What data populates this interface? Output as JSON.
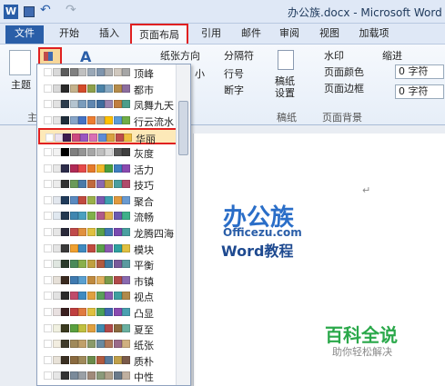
{
  "titlebar": {
    "title": "办公族.docx - Microsoft Word",
    "minimize": "–",
    "maximize": "□",
    "app_icon": "W",
    "undo": "↶",
    "redo": "↷"
  },
  "tabs": [
    {
      "label": "文件",
      "active": false
    },
    {
      "label": "开始",
      "active": false
    },
    {
      "label": "插入",
      "active": false
    },
    {
      "label": "页面布局",
      "active": true
    },
    {
      "label": "引用",
      "active": false
    },
    {
      "label": "邮件",
      "active": false
    },
    {
      "label": "审阅",
      "active": false
    },
    {
      "label": "视图",
      "active": false
    },
    {
      "label": "加载项",
      "active": false
    }
  ],
  "ribbon": {
    "themes_label": "主题",
    "themes_group": "主题",
    "paper_direction": "纸张方向",
    "separator": "分隔符",
    "line_number": "行号",
    "hyphenation": "断字",
    "small": "小",
    "draft": "稿纸",
    "draft_settings": "稿纸\n设置",
    "draft_group": "稿纸",
    "watermark": "水印",
    "page_color": "页面颜色",
    "page_border": "页面边框",
    "page_bg_group": "页面背景",
    "indent_label": "缩进",
    "indent_left": "0 字符",
    "indent_right": "0 字符"
  },
  "colors": {
    "red_highlight": "#e02020",
    "accent_blue": "#2a5ea8"
  },
  "gallery": {
    "items": [
      {
        "label": "顶峰",
        "swatches": [
          "#ffffff",
          "#d9d9d9",
          "#5c5c5c",
          "#808080",
          "#c0c0c0",
          "#9aa8b7",
          "#7f95ad",
          "#b0b0b0",
          "#d0c8be",
          "#a6a6a6"
        ]
      },
      {
        "label": "都市",
        "swatches": [
          "#ffffff",
          "#d9d9d9",
          "#2a2a2a",
          "#c4b28c",
          "#d44b2a",
          "#8da04b",
          "#4b83a8",
          "#88a9c2",
          "#b58c4b",
          "#8c6d9e"
        ]
      },
      {
        "label": "凤舞九天",
        "swatches": [
          "#ffffff",
          "#e2e2e2",
          "#2d3d4d",
          "#b4c4d0",
          "#7a9cbc",
          "#5f86b0",
          "#3f6c9e",
          "#9a84b0",
          "#c07e3f",
          "#4b9e8a"
        ]
      },
      {
        "label": "行云流水",
        "swatches": [
          "#ffffff",
          "#e4e4e4",
          "#1f2d3a",
          "#87a5c8",
          "#4472c4",
          "#ed7d31",
          "#a5a5a5",
          "#ffc000",
          "#5b9bd5",
          "#70ad47"
        ]
      },
      {
        "label": "华丽",
        "swatches": [
          "#ffffff",
          "#ece2f0",
          "#3c1c4f",
          "#cc4a7f",
          "#9a55c0",
          "#d96fb4",
          "#5e8bd6",
          "#d9a03f",
          "#bd4b4b",
          "#eebd3f"
        ]
      },
      {
        "label": "灰度",
        "swatches": [
          "#ffffff",
          "#f2f2f2",
          "#000000",
          "#7f7f7f",
          "#959595",
          "#a6a6a6",
          "#bfbfbf",
          "#d9d9d9",
          "#595959",
          "#3f3f3f"
        ]
      },
      {
        "label": "活力",
        "swatches": [
          "#ffffff",
          "#e8e8e8",
          "#2c2c4a",
          "#b02a56",
          "#e64a4a",
          "#e67a2a",
          "#f0b82a",
          "#4a9e3f",
          "#3f7ec0",
          "#8a4ab0"
        ]
      },
      {
        "label": "技巧",
        "swatches": [
          "#ffffff",
          "#ececec",
          "#333333",
          "#6a9a5a",
          "#4a7aa8",
          "#c06a3f",
          "#8a6ab0",
          "#c0a03f",
          "#4a9e9e",
          "#b04a6a"
        ]
      },
      {
        "label": "聚合",
        "swatches": [
          "#ffffff",
          "#e2e7ee",
          "#1f3a5a",
          "#5a8ac0",
          "#c04a3f",
          "#9ab04a",
          "#7a5ab0",
          "#3fa0b0",
          "#e09a3f",
          "#6a9ad0"
        ]
      },
      {
        "label": "流畅",
        "swatches": [
          "#ffffff",
          "#e0e8f0",
          "#22384f",
          "#3f86b0",
          "#4aa0c0",
          "#80b04a",
          "#b05a8a",
          "#e0b04a",
          "#6a5ab0",
          "#3fb08a"
        ]
      },
      {
        "label": "龙腾四海",
        "swatches": [
          "#ffffff",
          "#e6e6e6",
          "#2a2a3a",
          "#c04a4a",
          "#e0903f",
          "#e0c03f",
          "#5aa04a",
          "#3f7ab0",
          "#7a4ab0",
          "#4aa0a0"
        ]
      },
      {
        "label": "模块",
        "swatches": [
          "#ffffff",
          "#e4e4e4",
          "#3a3a3a",
          "#f0a030",
          "#3f8ac0",
          "#c04a3f",
          "#5aa04a",
          "#8a5ab0",
          "#30a0a0",
          "#e0c040"
        ]
      },
      {
        "label": "平衡",
        "swatches": [
          "#ffffff",
          "#dfe6e0",
          "#2a3a2a",
          "#4a8a5a",
          "#8ab04a",
          "#c0a03f",
          "#b05a3f",
          "#3f7aa0",
          "#7a5a9a",
          "#5a9aa0"
        ]
      },
      {
        "label": "市镇",
        "swatches": [
          "#ffffff",
          "#e6e0d8",
          "#3a2a1f",
          "#3f7ab0",
          "#5aa0d0",
          "#c08a3f",
          "#e0b060",
          "#7a9a4a",
          "#b04a4a",
          "#8a6ab0"
        ]
      },
      {
        "label": "视点",
        "swatches": [
          "#ffffff",
          "#e2e2e2",
          "#2a2a2a",
          "#c04a6a",
          "#3f8ac0",
          "#e0a03f",
          "#5aa05a",
          "#8a5ab0",
          "#3fa0a0",
          "#b08a4a"
        ]
      },
      {
        "label": "凸显",
        "swatches": [
          "#ffffff",
          "#e8e0e0",
          "#3a1f1f",
          "#c03f3f",
          "#e07a3f",
          "#e0c03f",
          "#4aa05a",
          "#3f6ab0",
          "#8a4ab0",
          "#4aa0b0"
        ]
      },
      {
        "label": "夏至",
        "swatches": [
          "#ffffff",
          "#f0f0e0",
          "#3a3a1f",
          "#5aa03f",
          "#c0c03f",
          "#e0a03f",
          "#3f8ab0",
          "#b04a4a",
          "#8a6a3f",
          "#6ab0a0"
        ]
      },
      {
        "label": "纸张",
        "swatches": [
          "#ffffff",
          "#f2ede0",
          "#3f3a2a",
          "#a08a5a",
          "#c0a06a",
          "#8a9a6a",
          "#6a8aa0",
          "#b07a5a",
          "#9a6a8a",
          "#d0b080"
        ]
      },
      {
        "label": "质朴",
        "swatches": [
          "#ffffff",
          "#e8e2d8",
          "#3a2f22",
          "#8a6a3f",
          "#a08a5a",
          "#6a8a4a",
          "#b05a3f",
          "#5a7a9a",
          "#c0a04a",
          "#7a5a4a"
        ]
      },
      {
        "label": "中性",
        "swatches": [
          "#ffffff",
          "#e6e6e6",
          "#333333",
          "#7a8a9a",
          "#9aa0a6",
          "#a08a7a",
          "#8a9a7a",
          "#b0a08a",
          "#6a7a8a",
          "#c0b0a0"
        ]
      }
    ]
  },
  "document": {
    "logo_cn": "办公族",
    "logo_url": "Officezu.com",
    "logo_sub": "Word教程",
    "brand": "百科全说",
    "brand_sub": "助你轻松解决",
    "return_mark": "↵"
  }
}
